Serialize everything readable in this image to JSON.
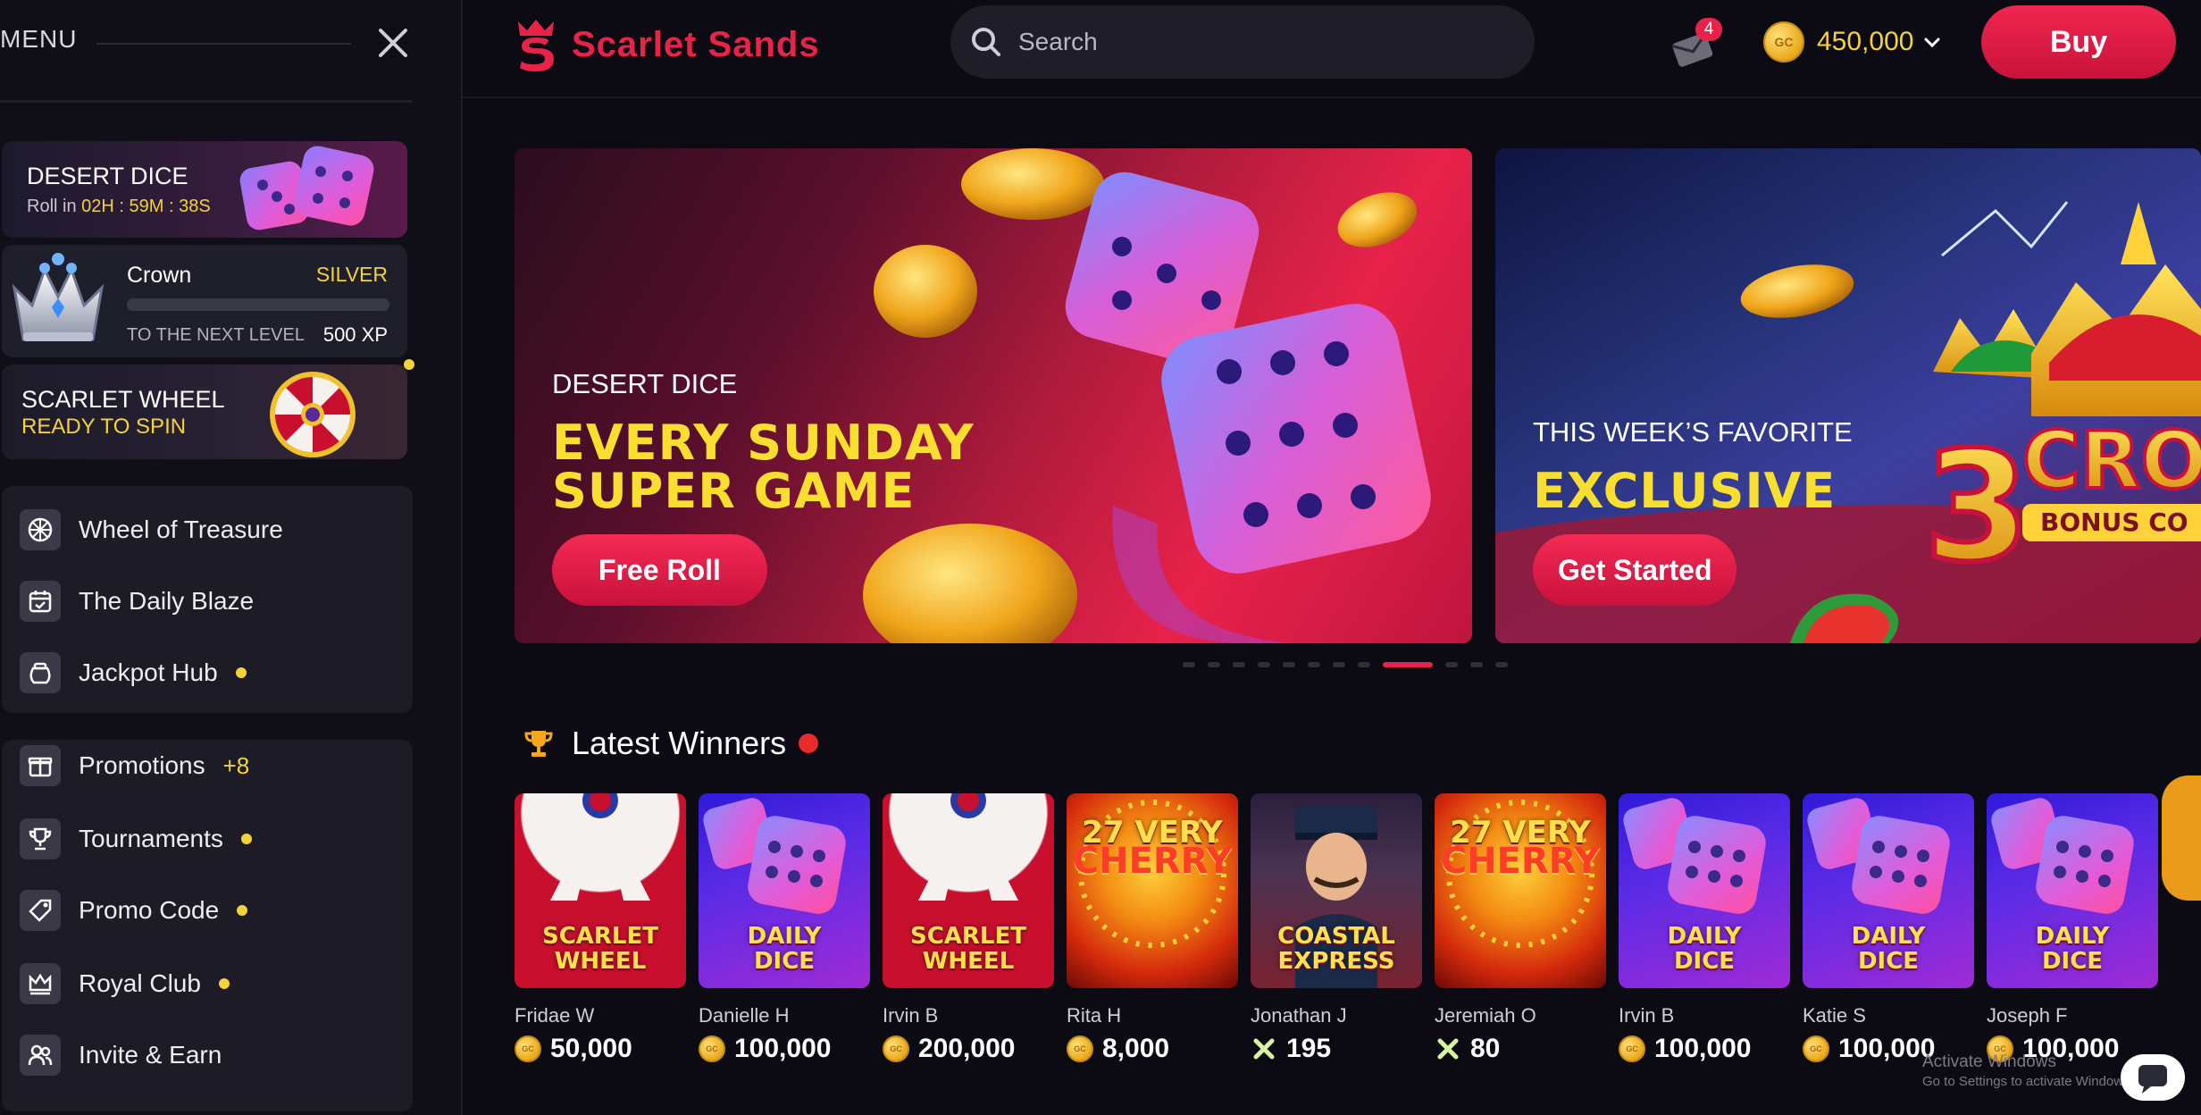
{
  "sidebar": {
    "menu_title": "MENU",
    "desert_dice": {
      "title": "DESERT DICE",
      "roll_prefix": "Roll in",
      "timer": "02H : 59M : 38S"
    },
    "crown": {
      "name": "Crown",
      "tier": "SILVER",
      "progress": 0.0,
      "next_label": "TO THE NEXT LEVEL",
      "xp": "500 XP"
    },
    "scarlet_wheel": {
      "title": "SCARLET WHEEL",
      "status": "READY TO SPIN"
    },
    "group1": [
      {
        "label": "Wheel of Treasure",
        "icon": "wheel-icon"
      },
      {
        "label": "The Daily Blaze",
        "icon": "calendar-icon"
      },
      {
        "label": "Jackpot Hub",
        "icon": "pot-icon",
        "dot": true
      }
    ],
    "group2": [
      {
        "label": "Promotions",
        "icon": "gift-icon",
        "badge": "+8"
      },
      {
        "label": "Tournaments",
        "icon": "trophy-icon",
        "dot": true
      },
      {
        "label": "Promo Code",
        "icon": "tag-icon",
        "dot": true
      },
      {
        "label": "Royal Club",
        "icon": "crown-icon",
        "dot": true
      },
      {
        "label": "Invite & Earn",
        "icon": "users-icon"
      }
    ]
  },
  "header": {
    "brand": "Scarlet Sands",
    "search_placeholder": "Search",
    "messages_count": "4",
    "balance": "450,000",
    "coin_label": "GC",
    "buy_label": "Buy"
  },
  "banners": [
    {
      "kicker": "DESERT DICE",
      "headline_1": "EVERY SUNDAY",
      "headline_2": "SUPER GAME",
      "cta": "Free Roll"
    },
    {
      "kicker": "THIS WEEK’S FAVORITE",
      "headline_1": "EXCLUSIVE",
      "cta": "Get Started",
      "art_text_1": "3",
      "art_text_2": "CROW",
      "art_text_3": "BONUS CO"
    }
  ],
  "pager": {
    "count": 12,
    "active": 8
  },
  "winners": {
    "title": "Latest Winners",
    "items": [
      {
        "game_1": "SCARLET",
        "game_2": "WHEEL",
        "tile": "wheel",
        "name": "Fridae W",
        "amount": "50,000",
        "currency": "gc"
      },
      {
        "game_1": "DAILY",
        "game_2": "DICE",
        "tile": "dice",
        "name": "Danielle H",
        "amount": "100,000",
        "currency": "gc"
      },
      {
        "game_1": "SCARLET",
        "game_2": "WHEEL",
        "tile": "wheel",
        "name": "Irvin B",
        "amount": "200,000",
        "currency": "gc"
      },
      {
        "game_1": "27 VERY",
        "game_2": "CHERRY",
        "tile": "cherry",
        "name": "Rita H",
        "amount": "8,000",
        "currency": "gc"
      },
      {
        "game_1": "COASTAL",
        "game_2": "EXPRESS",
        "tile": "coastal",
        "name": "Jonathan J",
        "amount": "195",
        "currency": "x"
      },
      {
        "game_1": "27 VERY",
        "game_2": "CHERRY",
        "tile": "cherry",
        "name": "Jeremiah O",
        "amount": "80",
        "currency": "x"
      },
      {
        "game_1": "DAILY",
        "game_2": "DICE",
        "tile": "dice",
        "name": "Irvin B",
        "amount": "100,000",
        "currency": "gc"
      },
      {
        "game_1": "DAILY",
        "game_2": "DICE",
        "tile": "dice",
        "name": "Katie S",
        "amount": "100,000",
        "currency": "gc"
      },
      {
        "game_1": "DAILY",
        "game_2": "DICE",
        "tile": "dice",
        "name": "Joseph F",
        "amount": "100,000",
        "currency": "gc"
      }
    ]
  },
  "os_overlay": {
    "line1": "Activate Windows",
    "line2": "Go to Settings to activate Windows."
  },
  "colors": {
    "brand_red": "#e8234a",
    "gold": "#f4d23a",
    "bg": "#0c0b13",
    "panel": "#1c1b26"
  }
}
